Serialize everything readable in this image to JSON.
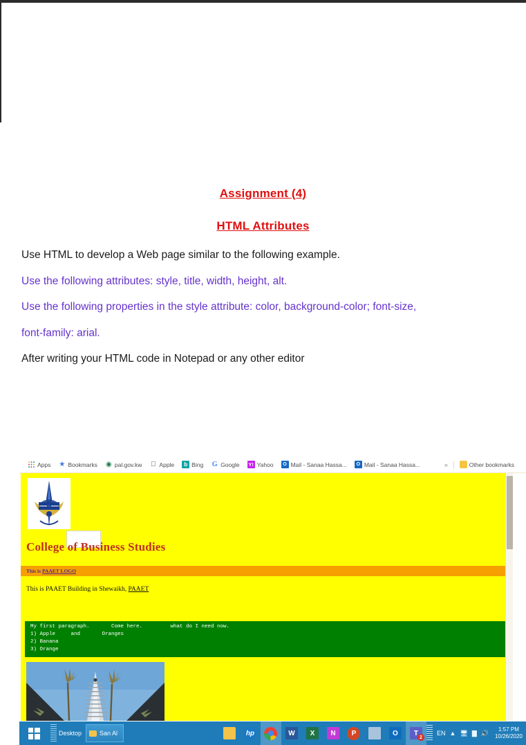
{
  "document": {
    "title_line1": "Assignment (4)",
    "title_line2": "HTML Attributes",
    "paragraphs": [
      "Use HTML to develop a Web page similar to the following example.",
      "Use the following attributes: style, title, width, height, alt.",
      "Use the following properties in the style attribute: color, background-color; font-size,",
      "font-family: arial.",
      "After writing your HTML code in Notepad or any other editor"
    ],
    "heading_color": "#e01010",
    "violet_color": "#6633cc"
  },
  "browser": {
    "bookmarks": [
      {
        "label": "Apps",
        "icon": "apps-grid-icon"
      },
      {
        "label": "Bookmarks",
        "icon": "star-icon"
      },
      {
        "label": "pal.gov.kw",
        "icon": "globe-icon"
      },
      {
        "label": "Apple",
        "icon": "apple-icon"
      },
      {
        "label": "Bing",
        "icon": "bing-icon"
      },
      {
        "label": "Google",
        "icon": "google-icon"
      },
      {
        "label": "Yahoo",
        "icon": "yahoo-icon"
      },
      {
        "label": "Mail - Sanaa Hassa...",
        "icon": "outlook-mail-icon"
      },
      {
        "label": "Mail - Sanaa Hassa...",
        "icon": "outlook-mail-icon"
      }
    ],
    "overflow_label": "»",
    "other_bookmarks_label": "Other bookmarks"
  },
  "webpage": {
    "background_color": "#ffff00",
    "logo_alt": "PAAET LOGO",
    "heading": "College of Business Studies",
    "heading_color": "#c03020",
    "orange_bar": {
      "background_color": "#f5a000",
      "prefix": "This is ",
      "link": "PAAET LOGO",
      "text_color": "#5a2a80"
    },
    "building_line": {
      "prefix": "This is PAAET Building in Shewaikh, ",
      "link": "PAAET"
    },
    "green_block": {
      "background_color": "#008000",
      "text_color": "#ffffff",
      "lines": [
        "My first paragraph.       Come here.         what do I need now.",
        "1) Apple     and       Oranges",
        "2) Banana",
        "3) Orange"
      ]
    },
    "photo_alt": "PAAET Building in Shewaikh"
  },
  "taskbar": {
    "start_label": "Start",
    "toolbar_label": "Desktop",
    "task_label": "San Al",
    "apps": [
      {
        "name": "file-explorer",
        "label": ""
      },
      {
        "name": "hp-support-assistant",
        "label": "hp"
      },
      {
        "name": "google-chrome",
        "label": ""
      },
      {
        "name": "microsoft-word",
        "label": "W"
      },
      {
        "name": "microsoft-excel",
        "label": "X"
      },
      {
        "name": "microsoft-onenote",
        "label": "N"
      },
      {
        "name": "microsoft-powerpoint",
        "label": "P"
      },
      {
        "name": "snipping-tool",
        "label": ""
      },
      {
        "name": "microsoft-outlook",
        "label": "O"
      },
      {
        "name": "microsoft-teams",
        "label": "T"
      }
    ],
    "teams_badge": "2",
    "language": "EN",
    "time": "1:57 PM",
    "date": "10/26/2020"
  }
}
